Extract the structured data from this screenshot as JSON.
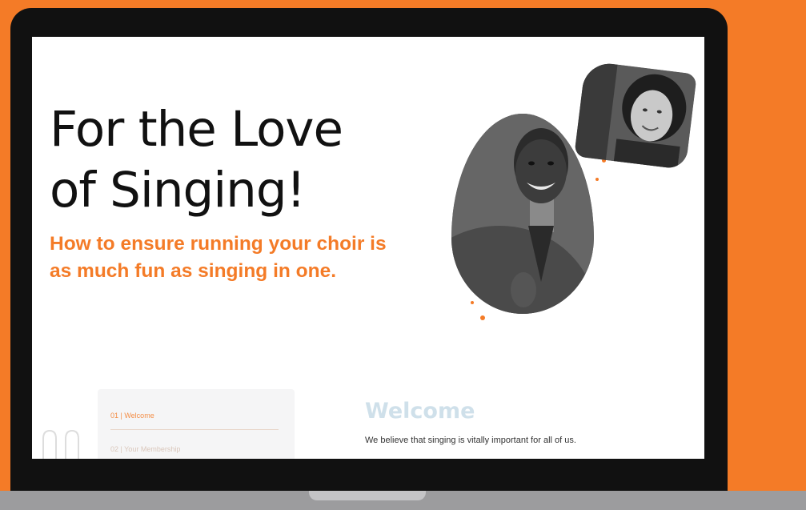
{
  "hero": {
    "title_line1": "For the Love",
    "title_line2": "of Singing!",
    "subtitle_line1": "How to ensure running your choir is",
    "subtitle_line2": "as much fun as singing in one."
  },
  "toc": {
    "items": [
      {
        "label": "01 | Welcome"
      },
      {
        "label": "02 | Your Membership"
      }
    ]
  },
  "welcome": {
    "heading": "Welcome",
    "text": "We believe that singing is vitally important for all of us."
  },
  "colors": {
    "accent": "#F47B27",
    "background": "#F47B27",
    "bezel": "#111111",
    "screen": "#FFFFFF"
  }
}
